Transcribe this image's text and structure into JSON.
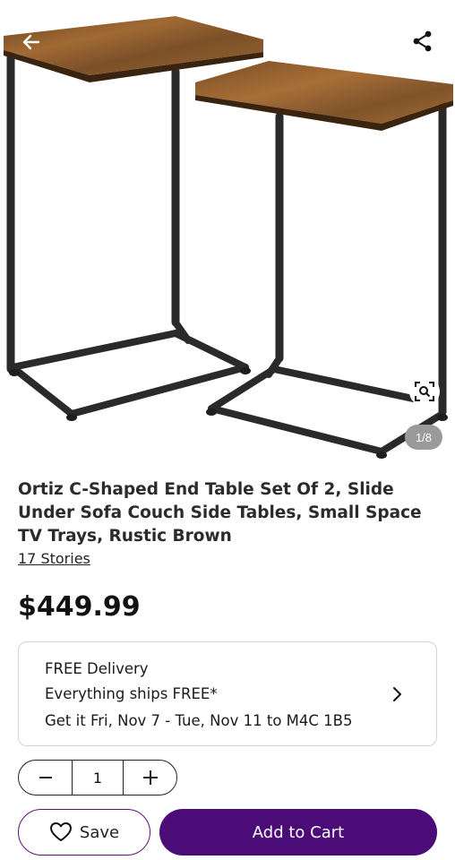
{
  "colors": {
    "primary": "#4b0c78",
    "save_border": "#5d0f7d",
    "card_border": "#d3d3d3",
    "counter_bg": "#9a9a9a",
    "wood": "#8a5a2b",
    "metal": "#2a2a2a"
  },
  "header": {
    "back_icon": "arrow-left-icon",
    "share_icon": "share-icon",
    "zoom_icon": "zoom-search-icon",
    "image_counter": "1/8"
  },
  "product": {
    "title": "Ortiz C-Shaped End Table Set Of 2, Slide Under Sofa Couch Side Tables, Small Space TV Trays, Rustic Brown",
    "brand": "17 Stories",
    "price": "$449.99"
  },
  "delivery": {
    "line1": "FREE Delivery",
    "line2": "Everything ships FREE*",
    "line3": "Get it Fri, Nov 7 - Tue, Nov 11 to M4C 1B5",
    "chevron_icon": "chevron-right-icon"
  },
  "quantity": {
    "value": "1",
    "minus_icon": "minus-icon",
    "plus_icon": "plus-icon"
  },
  "actions": {
    "save_label": "Save",
    "save_icon": "heart-icon",
    "add_to_cart_label": "Add to Cart"
  }
}
